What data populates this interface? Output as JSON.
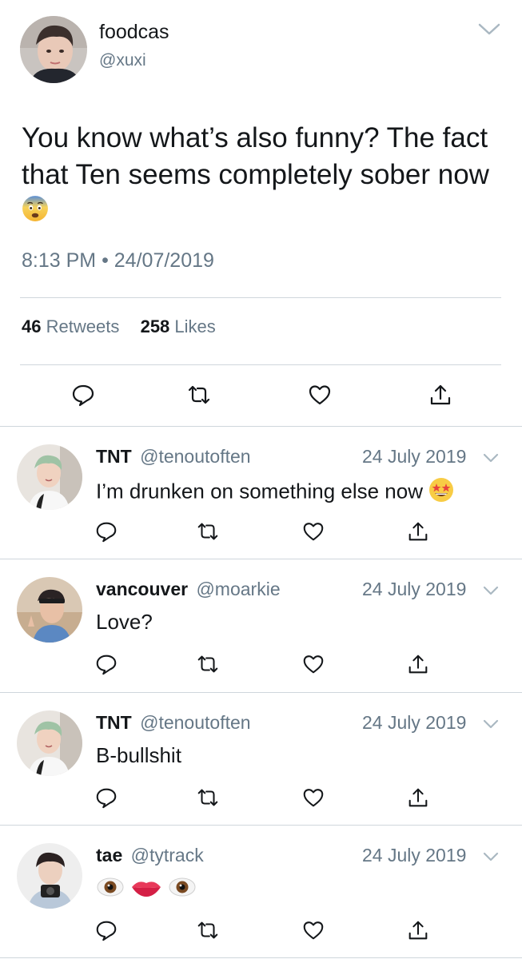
{
  "main_tweet": {
    "display_name": "foodcas",
    "handle": "@xuxi",
    "text": "You know what’s also funny? The fact that Ten seems completely sober now",
    "emoji": "fearful-face",
    "time": "8:13 PM",
    "separator": "•",
    "date": "24/07/2019",
    "retweets_count": "46",
    "retweets_label": "Retweets",
    "likes_count": "258",
    "likes_label": "Likes",
    "actions": [
      "reply-icon",
      "retweet-icon",
      "like-icon",
      "share-icon"
    ]
  },
  "replies": [
    {
      "name": "TNT",
      "handle": "@tenoutoften",
      "date": "24 July 2019",
      "text": "I’m drunken on something else now",
      "emoji": [
        "star-struck-face"
      ]
    },
    {
      "name": "vancouver",
      "handle": "@moarkie",
      "date": "24 July 2019",
      "text": "Love?",
      "emoji": []
    },
    {
      "name": "TNT",
      "handle": "@tenoutoften",
      "date": "24 July 2019",
      "text": "B-bullshit",
      "emoji": []
    },
    {
      "name": "tae",
      "handle": "@tytrack",
      "date": "24 July 2019",
      "text": "",
      "emoji": [
        "eye",
        "lips",
        "eye"
      ]
    }
  ],
  "colors": {
    "text": "#14171a",
    "secondary": "#657786",
    "divider": "#cfd6dc"
  }
}
